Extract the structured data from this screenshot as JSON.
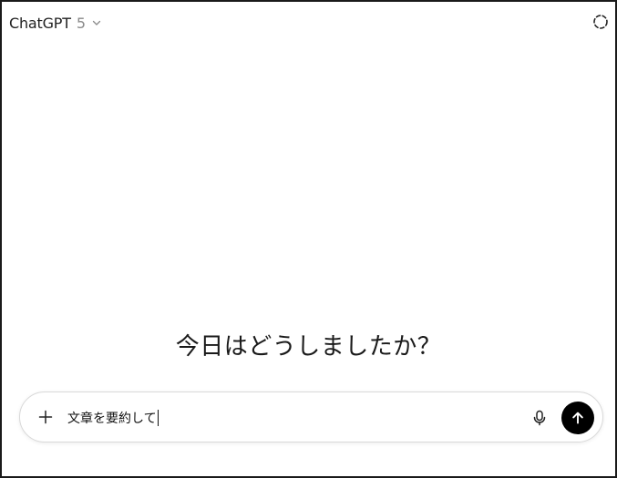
{
  "header": {
    "model_name": "ChatGPT",
    "model_version": "5",
    "model_dropdown_icon": "chevron-down-icon",
    "temporary_chat_icon": "dashed-circle-icon"
  },
  "main": {
    "greeting": "今日はどうしましたか？"
  },
  "composer": {
    "add_icon": "plus-icon",
    "input_value": "文章を要約して",
    "mic_icon": "microphone-icon",
    "send_icon": "arrow-up-icon"
  },
  "colors": {
    "send_button": "#000000",
    "composer_border": "#d9d9d9",
    "model_version_text": "#8a8a8a"
  }
}
